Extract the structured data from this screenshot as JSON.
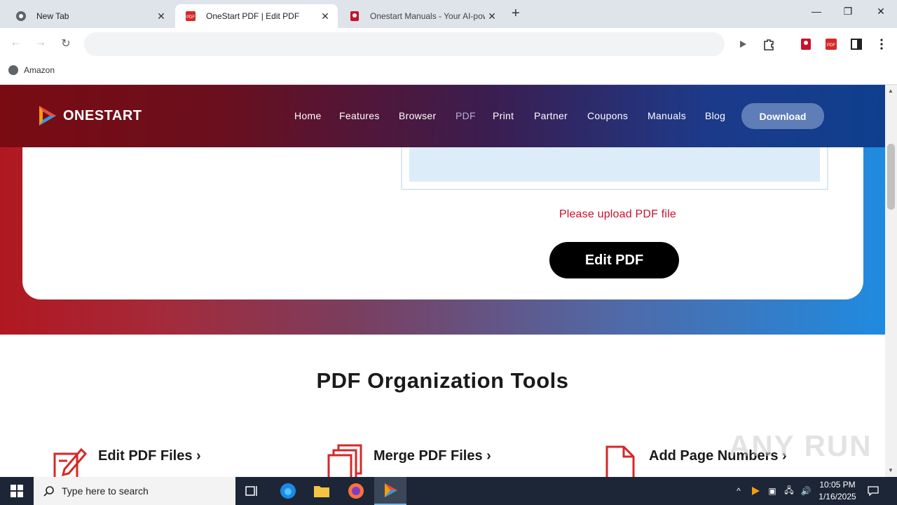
{
  "browser": {
    "tabs": [
      {
        "title": "New Tab",
        "icon": "chrome-icon",
        "active": false
      },
      {
        "title": "OneStart PDF | Edit PDF",
        "icon": "pdf-icon",
        "active": true
      },
      {
        "title": "Onestart Manuals - Your AI-pow",
        "icon": "manuals-icon",
        "active": false
      }
    ],
    "address_value": "",
    "bookmarks": [
      {
        "label": "Amazon",
        "icon": "globe-icon"
      }
    ]
  },
  "site": {
    "logo_text": "ONESTART",
    "nav": [
      "Home",
      "Features",
      "Browser",
      "PDF",
      "Print",
      "Partner",
      "Coupons",
      "Manuals",
      "Blog"
    ],
    "active_nav": "PDF",
    "download_label": "Download",
    "upload_error": "Please upload PDF file",
    "edit_button": "Edit PDF",
    "section_title": "PDF Organization Tools",
    "tools": [
      {
        "name": "Edit PDF Files ›",
        "icon": "edit-pdf-icon"
      },
      {
        "name": "Merge PDF Files ›",
        "icon": "merge-pdf-icon"
      },
      {
        "name": "Add Page Numbers ›",
        "icon": "page-numbers-icon"
      }
    ],
    "colors": {
      "brand_red": "#c8102e",
      "header_start": "#7a0b12",
      "header_end": "#0e3f8e",
      "download_btn": "#5f7db6"
    }
  },
  "watermark": "ANY RUN",
  "taskbar": {
    "search_placeholder": "Type here to search",
    "time": "10:05 PM",
    "date": "1/16/2025"
  }
}
